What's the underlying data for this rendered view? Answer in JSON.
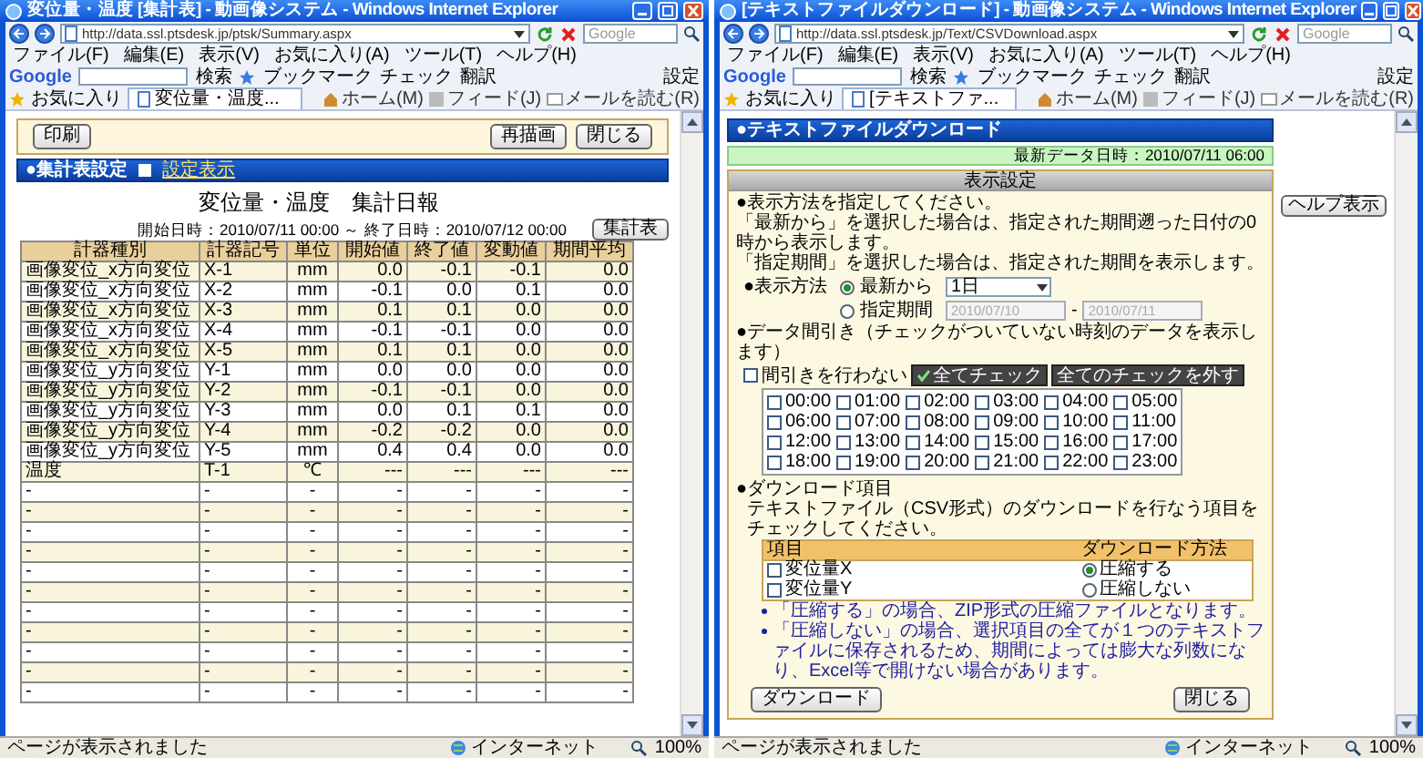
{
  "windows": [
    {
      "title": "変位量・温度 [集計表] - 動画像システム - Windows Internet Explorer",
      "address": "http://data.ssl.ptsdesk.jp/ptsk/Summary.aspx",
      "search_placeholder": "Google",
      "menu": [
        "ファイル(F)",
        "編集(E)",
        "表示(V)",
        "お気に入り(A)",
        "ツール(T)",
        "ヘルプ(H)"
      ],
      "toolbar": {
        "brand": "Google",
        "search": "検索",
        "items": [
          "ブックマーク",
          "チェック",
          "翻訳"
        ],
        "settings": "設定"
      },
      "favorites": "お気に入り",
      "tab": "変位量・温度...",
      "commands": [
        "ホーム(M)",
        "フィード(J)",
        "メールを読む(R)"
      ],
      "status": {
        "text": "ページが表示されました",
        "zone": "インターネット",
        "zoom": "100%"
      },
      "page": {
        "kind": "report",
        "toolbar": {
          "left": [
            "印刷"
          ],
          "right": [
            "再描画",
            "閉じる"
          ]
        },
        "header": "●集計表設定",
        "header_link": "設定表示",
        "title": "変位量・温度　集計日報",
        "period": "開始日時：2010/07/11 00:00 ～ 終了日時：2010/07/12 00:00",
        "action": "集計表",
        "columns": [
          "計器種別",
          "計器記号",
          "単位",
          "開始値",
          "終了値",
          "変動値",
          "期間平均"
        ],
        "rows": [
          [
            "画像変位_x方向変位",
            "X-1",
            "mm",
            "0.0",
            "-0.1",
            "-0.1",
            "0.0"
          ],
          [
            "画像変位_x方向変位",
            "X-2",
            "mm",
            "-0.1",
            "0.0",
            "0.1",
            "0.0"
          ],
          [
            "画像変位_x方向変位",
            "X-3",
            "mm",
            "0.1",
            "0.1",
            "0.0",
            "0.0"
          ],
          [
            "画像変位_x方向変位",
            "X-4",
            "mm",
            "-0.1",
            "-0.1",
            "0.0",
            "0.0"
          ],
          [
            "画像変位_x方向変位",
            "X-5",
            "mm",
            "0.1",
            "0.1",
            "0.0",
            "0.0"
          ],
          [
            "画像変位_y方向変位",
            "Y-1",
            "mm",
            "0.0",
            "0.0",
            "0.0",
            "0.0"
          ],
          [
            "画像変位_y方向変位",
            "Y-2",
            "mm",
            "-0.1",
            "-0.1",
            "0.0",
            "0.0"
          ],
          [
            "画像変位_y方向変位",
            "Y-3",
            "mm",
            "0.0",
            "0.1",
            "0.1",
            "0.0"
          ],
          [
            "画像変位_y方向変位",
            "Y-4",
            "mm",
            "-0.2",
            "-0.2",
            "0.0",
            "0.0"
          ],
          [
            "画像変位_y方向変位",
            "Y-5",
            "mm",
            "0.4",
            "0.4",
            "0.0",
            "0.0"
          ],
          [
            "温度",
            "T-1",
            "℃",
            "---",
            "---",
            "---",
            "---"
          ],
          [
            "-",
            "-",
            "-",
            "-",
            "-",
            "-",
            "-"
          ],
          [
            "-",
            "-",
            "-",
            "-",
            "-",
            "-",
            "-"
          ],
          [
            "-",
            "-",
            "-",
            "-",
            "-",
            "-",
            "-"
          ],
          [
            "-",
            "-",
            "-",
            "-",
            "-",
            "-",
            "-"
          ],
          [
            "-",
            "-",
            "-",
            "-",
            "-",
            "-",
            "-"
          ],
          [
            "-",
            "-",
            "-",
            "-",
            "-",
            "-",
            "-"
          ],
          [
            "-",
            "-",
            "-",
            "-",
            "-",
            "-",
            "-"
          ],
          [
            "-",
            "-",
            "-",
            "-",
            "-",
            "-",
            "-"
          ],
          [
            "-",
            "-",
            "-",
            "-",
            "-",
            "-",
            "-"
          ],
          [
            "-",
            "-",
            "-",
            "-",
            "-",
            "-",
            "-"
          ],
          [
            "-",
            "-",
            "-",
            "-",
            "-",
            "-",
            "-"
          ]
        ]
      }
    },
    {
      "title": "[テキストファイルダウンロード] - 動画像システム - Windows Internet Explorer",
      "address": "http://data.ssl.ptsdesk.jp/Text/CSVDownload.aspx",
      "search_placeholder": "Google",
      "menu": [
        "ファイル(F)",
        "編集(E)",
        "表示(V)",
        "お気に入り(A)",
        "ツール(T)",
        "ヘルプ(H)"
      ],
      "toolbar": {
        "brand": "Google",
        "search": "検索",
        "items": [
          "ブックマーク",
          "チェック",
          "翻訳"
        ],
        "settings": "設定"
      },
      "favorites": "お気に入り",
      "tab": "[テキストファ...",
      "commands": [
        "ホーム(M)",
        "フィード(J)",
        "メールを読む(R)"
      ],
      "status": {
        "text": "ページが表示されました",
        "zone": "インターネット",
        "zoom": "100%"
      },
      "page": {
        "kind": "download",
        "header": "●テキストファイルダウンロード",
        "latest": "最新データ日時：2010/07/11 06:00",
        "help": "ヘルプ表示",
        "panel_title": "表示設定",
        "intro": [
          "●表示方法を指定してください。",
          "「最新から」を選択した場合は、指定された期間遡った日付の0時から表示します。",
          "「指定期間」を選択した場合は、指定された期間を表示します。"
        ],
        "display": {
          "label": "●表示方法",
          "options": [
            {
              "label": "最新から",
              "selected": true
            },
            {
              "label": "指定期間",
              "selected": false
            }
          ],
          "range": "1日",
          "fields": [
            {
              "value": "2010/07/10",
              "disabled": true
            },
            {
              "value": "2010/07/11",
              "disabled": true
            }
          ],
          "separator": "-"
        },
        "thinning": {
          "label": "●データ間引き（チェックがついていない時刻のデータを表示します）",
          "no_thin": {
            "label": "間引きを行わない",
            "checked": false
          },
          "buttons": [
            {
              "label": "全てチェック",
              "kind": "check"
            },
            {
              "label": "全てのチェックを外す",
              "kind": "plain"
            }
          ],
          "hours": [
            {
              "label": "00:00",
              "checked": false
            },
            {
              "label": "01:00",
              "checked": false
            },
            {
              "label": "02:00",
              "checked": false
            },
            {
              "label": "03:00",
              "checked": false
            },
            {
              "label": "04:00",
              "checked": false
            },
            {
              "label": "05:00",
              "checked": false
            },
            {
              "label": "06:00",
              "checked": false
            },
            {
              "label": "07:00",
              "checked": false
            },
            {
              "label": "08:00",
              "checked": false
            },
            {
              "label": "09:00",
              "checked": false
            },
            {
              "label": "10:00",
              "checked": false
            },
            {
              "label": "11:00",
              "checked": false
            },
            {
              "label": "12:00",
              "checked": false
            },
            {
              "label": "13:00",
              "checked": false
            },
            {
              "label": "14:00",
              "checked": false
            },
            {
              "label": "15:00",
              "checked": false
            },
            {
              "label": "16:00",
              "checked": false
            },
            {
              "label": "17:00",
              "checked": false
            },
            {
              "label": "18:00",
              "checked": false
            },
            {
              "label": "19:00",
              "checked": false
            },
            {
              "label": "20:00",
              "checked": false
            },
            {
              "label": "21:00",
              "checked": false
            },
            {
              "label": "22:00",
              "checked": false
            },
            {
              "label": "23:00",
              "checked": false
            }
          ]
        },
        "download": {
          "label": "●ダウンロード項目",
          "note": "テキストファイル（CSV形式）のダウンロードを行なう項目をチェックしてください。",
          "columns": [
            "項目",
            "ダウンロード方法"
          ],
          "items": [
            {
              "label": "変位量X",
              "checked": false
            },
            {
              "label": "変位量Y",
              "checked": false
            }
          ],
          "methods": [
            {
              "label": "圧縮する",
              "selected": true
            },
            {
              "label": "圧縮しない",
              "selected": false
            }
          ],
          "notes": [
            "「圧縮する」の場合、ZIP形式の圧縮ファイルとなります。",
            "「圧縮しない」の場合、選択項目の全てが１つのテキストファイルに保存されるため、期間によっては膨大な列数になり、Excel等で開けない場合があります。"
          ]
        },
        "buttons": [
          "ダウンロード",
          "閉じる"
        ]
      }
    }
  ]
}
